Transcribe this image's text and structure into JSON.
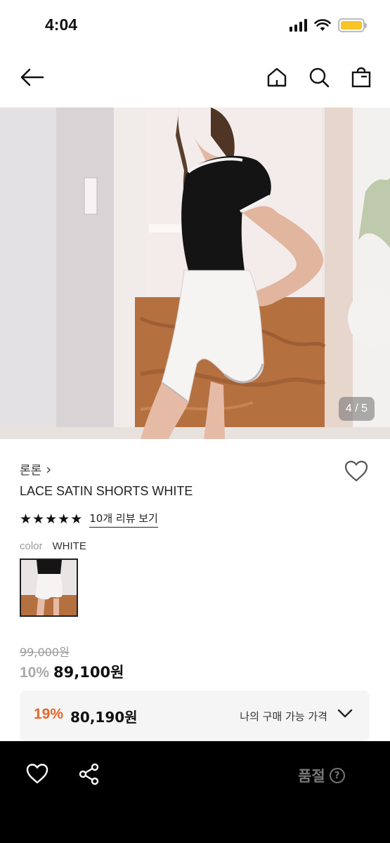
{
  "status_bar": {
    "time": "4:04",
    "battery_color": "#f7c325"
  },
  "nav": {
    "icons": [
      "back-arrow-icon",
      "home-icon",
      "search-icon",
      "shopping-bag-icon"
    ]
  },
  "hero": {
    "image_counter": "4 / 5"
  },
  "product": {
    "brand": "론론",
    "brand_chevron": "›",
    "name": "LACE SATIN SHORTS WHITE",
    "rating_stars": 5,
    "review_link": "10개 리뷰 보기",
    "color_label": "color",
    "color_value": "WHITE"
  },
  "price": {
    "original": "99,000원",
    "discount_rate": "10%",
    "sale_price": "89,100원",
    "my_discount_rate": "19%",
    "my_price": "80,190원",
    "my_price_label": "나의 구매 가능 가격",
    "accent_color": "#e7652b"
  },
  "bottom_bar": {
    "status_label": "품절",
    "help_glyph": "?"
  }
}
